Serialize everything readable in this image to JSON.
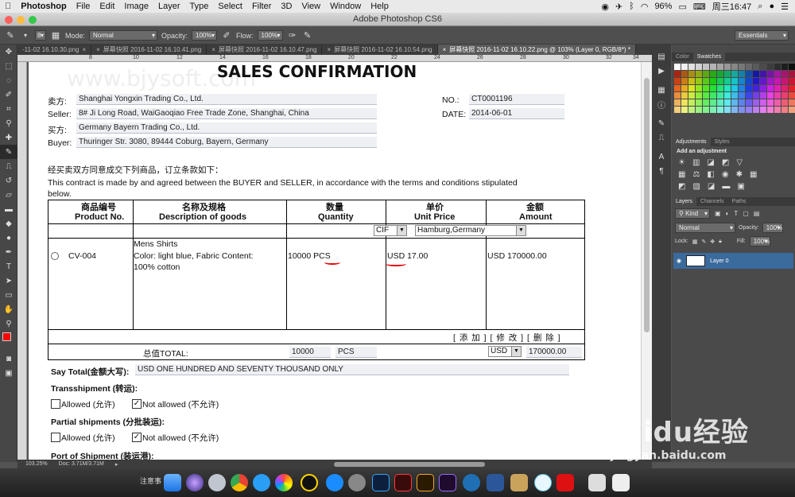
{
  "menubar": {
    "app": "Photoshop",
    "items": [
      "File",
      "Edit",
      "Image",
      "Layer",
      "Type",
      "Select",
      "Filter",
      "3D",
      "View",
      "Window",
      "Help"
    ],
    "battery": "96%",
    "clock": "周三16:47"
  },
  "window_title": "Adobe Photoshop CS6",
  "options": {
    "mode_label": "Mode:",
    "mode_value": "Normal",
    "opacity_label": "Opacity:",
    "opacity_value": "100%",
    "flow_label": "Flow:",
    "flow_value": "100%",
    "brush_size": "8",
    "workspace": "Essentials"
  },
  "doc_tabs": [
    "-11-02 16.10.30.png",
    "屏幕快照 2016-11-02 16.10.41.png",
    "屏幕快照 2016-11-02 16.10.47.png",
    "屏幕快照 2016-11-02 16.10.54.png",
    "屏幕快照 2016-11-02 16.10.22.png @ 103% (Layer 0, RGB/8*) *"
  ],
  "ruler_ticks": [
    "8",
    "10",
    "12",
    "14",
    "16",
    "18",
    "20",
    "22",
    "24",
    "26",
    "28",
    "30",
    "32",
    "34",
    "36",
    "38"
  ],
  "document": {
    "watermark": "www.bjysoft.com",
    "title": "SALES CONFIRMATION",
    "seller_cn": "卖方:",
    "seller_name": "Shanghai Yongxin Trading Co., Ltd.",
    "seller_en": "Seller:",
    "seller_address": "8# Ji Long Road, WaiGaoqiao Free Trade Zone, Shanghai, China",
    "buyer_cn": "买方:",
    "buyer_name": "Germany Bayern Trading Co., Ltd.",
    "buyer_en": "Buyer:",
    "buyer_address": "Thuringer Str. 3080, 89444 Coburg, Bayern, Germany",
    "no_label": "NO.:",
    "no_value": "CT0001196",
    "date_label": "DATE:",
    "date_value": "2014-06-01",
    "intro_cn": "经买卖双方同意成交下列商品，订立条款如下：",
    "intro_en_1": "This contract is made by and agreed between the BUYER and SELLER, in accordance with the terms and conditions stipulated",
    "intro_en_2": "below.",
    "col_product_cn": "商品编号",
    "col_product_en": "Product No.",
    "col_desc_cn": "名称及规格",
    "col_desc_en": "Description of goods",
    "col_qty_cn": "数量",
    "col_qty_en": "Quantity",
    "col_price_cn": "单价",
    "col_price_en": "Unit Price",
    "col_amount_cn": "金额",
    "col_amount_en": "Amount",
    "term": "CIF",
    "port": "Hamburg,Germany",
    "product_no": "CV-004",
    "desc_1": "Mens Shirts",
    "desc_2": "Color: light blue, Fabric Content:",
    "desc_3": "100% cotton",
    "quantity": "10000 PCS",
    "unit_price": "USD 17.00",
    "amount": "USD 170000.00",
    "row_actions": "[ 添 加 ] [ 修 改 ] [ 删 除 ]",
    "total_label": "总值TOTAL:",
    "total_qty": "10000",
    "total_unit": "PCS",
    "total_currency": "USD",
    "total_amount": "170000.00",
    "say_total_label": "Say Total(金额大写):",
    "say_total_value": "USD ONE HUNDRED AND SEVENTY THOUSAND ONLY",
    "transshipment_label": "Transshipment (转运):",
    "allowed": "Allowed (允许)",
    "not_allowed": "Not allowed (不允许)",
    "partial_label": "Partial shipments (分批装运):",
    "port_shipment_label": "Port of Shipment (装运港):"
  },
  "status": {
    "zoom": "103.25%",
    "doc_size": "Doc: 3.71M/3.71M"
  },
  "panels": {
    "color_tab": "Color",
    "swatches_tab": "Swatches",
    "adjustments_tab": "Adjustments",
    "styles_tab": "Styles",
    "add_adjustment": "Add an adjustment",
    "layers_tab": "Layers",
    "channels_tab": "Channels",
    "paths_tab": "Paths",
    "kind": "Kind",
    "blend": "Normal",
    "opacity_label": "Opacity:",
    "opacity_value": "100%",
    "lock_label": "Lock:",
    "fill_label": "Fill:",
    "fill_value": "100%",
    "layer_name": "Layer 0"
  },
  "dock": {
    "note_text": "注意事"
  },
  "watermark": {
    "brand": "Baidu经验",
    "url": "jingyan.baidu.com"
  },
  "colors": {
    "annotation_red": "#e60000",
    "selected_layer": "#3b6a9c",
    "foreground": "#ff0000",
    "background": "#ffffff"
  }
}
